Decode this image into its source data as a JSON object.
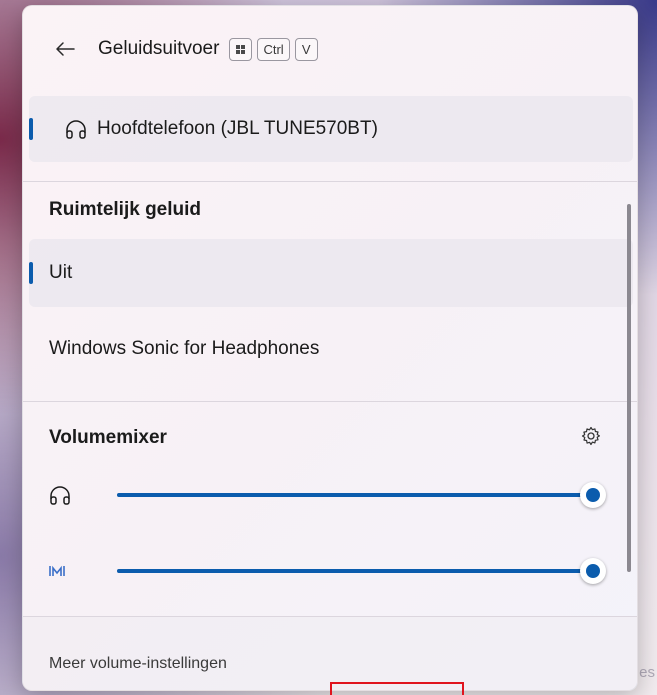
{
  "header": {
    "title": "Geluidsuitvoer",
    "back_icon": "arrow-left-icon",
    "shortcut": {
      "win_key": "windows-logo-icon",
      "ctrl": "Ctrl",
      "v": "V"
    }
  },
  "device": {
    "label": "Hoofdtelefoon (JBL TUNE570BT)",
    "icon": "headphones-icon",
    "selected": true
  },
  "spatial_sound": {
    "title": "Ruimtelijk geluid",
    "options": [
      {
        "label": "Uit",
        "selected": true
      },
      {
        "label": "Windows Sonic for Headphones",
        "selected": false
      }
    ]
  },
  "volume_mixer": {
    "title": "Volumemixer",
    "settings_icon": "gear-icon",
    "sliders": [
      {
        "icon": "headphones-icon",
        "value": 100
      },
      {
        "icon": "app-logo-icon",
        "value": 100
      }
    ]
  },
  "footer": {
    "link_label": "Meer volume-instellingen"
  },
  "background_text": "es",
  "colors": {
    "accent": "#0b5cad",
    "annotation": "#e0141e"
  }
}
